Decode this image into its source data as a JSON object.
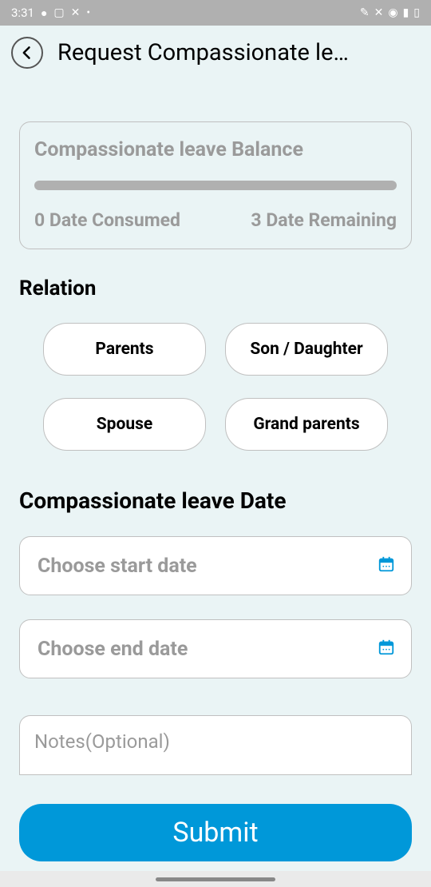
{
  "statusBar": {
    "time": "3:31",
    "leftIcons": [
      "💡",
      "🖼",
      "✖",
      "•"
    ],
    "rightIcons": [
      "✏",
      "🔕",
      "📶",
      "📊",
      "🔋"
    ]
  },
  "header": {
    "title": "Request Compassionate le…"
  },
  "balance": {
    "title": "Compassionate leave Balance",
    "consumed": "0 Date Consumed",
    "remaining": "3 Date Remaining"
  },
  "relation": {
    "label": "Relation",
    "options": [
      "Parents",
      "Son / Daughter",
      "Spouse",
      "Grand parents"
    ]
  },
  "dateSection": {
    "title": "Compassionate leave Date",
    "startPlaceholder": "Choose start date",
    "endPlaceholder": "Choose end date"
  },
  "notes": {
    "placeholder": "Notes(Optional)"
  },
  "submit": {
    "label": "Submit"
  }
}
